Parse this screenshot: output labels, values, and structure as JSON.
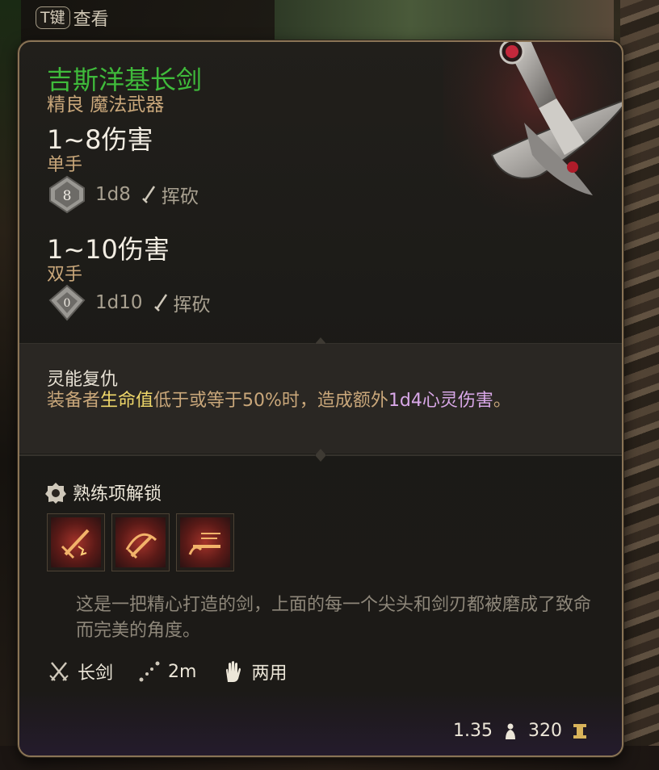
{
  "hint": {
    "key": "T键",
    "label": "查看"
  },
  "item": {
    "name": "吉斯洋基长剑",
    "rarity": "精良 魔法武器",
    "one_handed": {
      "damage": "1~8伤害",
      "grip": "单手",
      "die_face": "8",
      "dice": "1d8",
      "damage_type": "挥砍"
    },
    "two_handed": {
      "damage": "1~10伤害",
      "grip": "双手",
      "die_face": "0",
      "dice": "1d10",
      "damage_type": "挥砍"
    },
    "passive": {
      "name": "灵能复仇",
      "desc_prefix": "装备者",
      "desc_hp": "生命值",
      "desc_mid": "低于或等于50%时，造成额外",
      "desc_psy": "1d4心灵伤害",
      "desc_suffix": "。"
    },
    "proficiency": {
      "label": "熟练项解锁",
      "actions": [
        "action-icon-1",
        "action-icon-2",
        "action-icon-3"
      ]
    },
    "flavor": "这是一把精心打造的剑，上面的每一个尖头和剑刃都被磨成了致命而完美的角度。",
    "properties": {
      "type": "长剑",
      "range": "2m",
      "hands": "两用"
    },
    "weight": "1.35",
    "price": "320"
  },
  "colors": {
    "name": "#3fbb3b",
    "accent": "#c9a77a",
    "hp": "#f0d86a",
    "psychic": "#d9a8e8",
    "border": "#8a7456"
  }
}
